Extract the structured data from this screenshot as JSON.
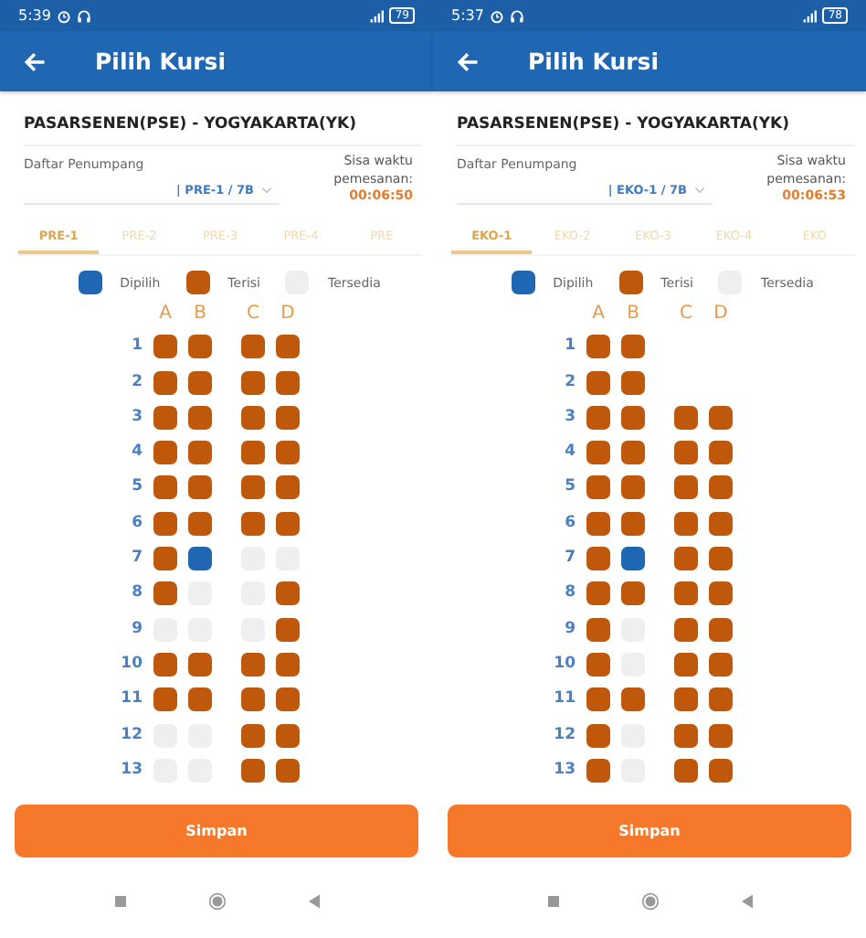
{
  "phones": [
    {
      "status_bar": {
        "time": "5:39",
        "battery": "79"
      },
      "title": "Pilih Kursi",
      "route": "PASARSENEN(PSE) - YOGYAKARTA(YK)",
      "passenger_label": "Daftar Penumpang",
      "passenger_value": "| PRE-1 / 7B",
      "timer_label": "Sisa waktu pemesanan:",
      "timer": "00:06:50",
      "tabs": [
        {
          "label": "PRE-1",
          "selected": true
        },
        {
          "label": "PRE-2",
          "selected": false
        },
        {
          "label": "PRE-3",
          "selected": false
        },
        {
          "label": "PRE-4",
          "selected": false
        },
        {
          "label": "PRE",
          "selected": false
        }
      ],
      "legend": [
        {
          "label": "Dipilih",
          "selected": true,
          "occupied": false
        },
        {
          "label": "Terisi",
          "selected": false,
          "occupied": true
        },
        {
          "label": "Tersedia",
          "selected": false,
          "occupied": false
        }
      ],
      "columns": [
        "A",
        "B",
        "C",
        "D"
      ],
      "rows": [
        {
          "number": "1",
          "seats": [
            {
              "selected": false,
              "occupied": true
            },
            {
              "selected": false,
              "occupied": true
            },
            {
              "selected": false,
              "occupied": true
            },
            {
              "selected": false,
              "occupied": true
            }
          ]
        },
        {
          "number": "2",
          "seats": [
            {
              "selected": false,
              "occupied": true
            },
            {
              "selected": false,
              "occupied": true
            },
            {
              "selected": false,
              "occupied": true
            },
            {
              "selected": false,
              "occupied": true
            }
          ]
        },
        {
          "number": "3",
          "seats": [
            {
              "selected": false,
              "occupied": true
            },
            {
              "selected": false,
              "occupied": true
            },
            {
              "selected": false,
              "occupied": true
            },
            {
              "selected": false,
              "occupied": true
            }
          ]
        },
        {
          "number": "4",
          "seats": [
            {
              "selected": false,
              "occupied": true
            },
            {
              "selected": false,
              "occupied": true
            },
            {
              "selected": false,
              "occupied": true
            },
            {
              "selected": false,
              "occupied": true
            }
          ]
        },
        {
          "number": "5",
          "seats": [
            {
              "selected": false,
              "occupied": true
            },
            {
              "selected": false,
              "occupied": true
            },
            {
              "selected": false,
              "occupied": true
            },
            {
              "selected": false,
              "occupied": true
            }
          ]
        },
        {
          "number": "6",
          "seats": [
            {
              "selected": false,
              "occupied": true
            },
            {
              "selected": false,
              "occupied": true
            },
            {
              "selected": false,
              "occupied": true
            },
            {
              "selected": false,
              "occupied": true
            }
          ]
        },
        {
          "number": "7",
          "seats": [
            {
              "selected": false,
              "occupied": true
            },
            {
              "selected": true,
              "occupied": false
            },
            {
              "selected": false,
              "occupied": false
            },
            {
              "selected": false,
              "occupied": false
            }
          ]
        },
        {
          "number": "8",
          "seats": [
            {
              "selected": false,
              "occupied": true
            },
            {
              "selected": false,
              "occupied": false
            },
            {
              "selected": false,
              "occupied": false
            },
            {
              "selected": false,
              "occupied": true
            }
          ]
        },
        {
          "number": "9",
          "seats": [
            {
              "selected": false,
              "occupied": false
            },
            {
              "selected": false,
              "occupied": false
            },
            {
              "selected": false,
              "occupied": false
            },
            {
              "selected": false,
              "occupied": true
            }
          ]
        },
        {
          "number": "10",
          "seats": [
            {
              "selected": false,
              "occupied": true
            },
            {
              "selected": false,
              "occupied": true
            },
            {
              "selected": false,
              "occupied": true
            },
            {
              "selected": false,
              "occupied": true
            }
          ]
        },
        {
          "number": "11",
          "seats": [
            {
              "selected": false,
              "occupied": true
            },
            {
              "selected": false,
              "occupied": true
            },
            {
              "selected": false,
              "occupied": true
            },
            {
              "selected": false,
              "occupied": true
            }
          ]
        },
        {
          "number": "12",
          "seats": [
            {
              "selected": false,
              "occupied": false
            },
            {
              "selected": false,
              "occupied": false
            },
            {
              "selected": false,
              "occupied": true
            },
            {
              "selected": false,
              "occupied": true
            }
          ]
        },
        {
          "number": "13",
          "seats": [
            {
              "selected": false,
              "occupied": false
            },
            {
              "selected": false,
              "occupied": false
            },
            {
              "selected": false,
              "occupied": true
            },
            {
              "selected": false,
              "occupied": true
            }
          ]
        }
      ],
      "button": "Simpan"
    },
    {
      "status_bar": {
        "time": "5:37",
        "battery": "78"
      },
      "title": "Pilih Kursi",
      "route": "PASARSENEN(PSE) - YOGYAKARTA(YK)",
      "passenger_label": "Daftar Penumpang",
      "passenger_value": "| EKO-1 / 7B",
      "timer_label": "Sisa waktu pemesanan:",
      "timer": "00:06:53",
      "tabs": [
        {
          "label": "EKO-1",
          "selected": true
        },
        {
          "label": "EKO-2",
          "selected": false
        },
        {
          "label": "EKO-3",
          "selected": false
        },
        {
          "label": "EKO-4",
          "selected": false
        },
        {
          "label": "EKO",
          "selected": false
        }
      ],
      "legend": [
        {
          "label": "Dipilih",
          "selected": true,
          "occupied": false
        },
        {
          "label": "Terisi",
          "selected": false,
          "occupied": true
        },
        {
          "label": "Tersedia",
          "selected": false,
          "occupied": false
        }
      ],
      "columns": [
        "A",
        "B",
        "C",
        "D"
      ],
      "rows": [
        {
          "number": "1",
          "seats": [
            {
              "selected": false,
              "occupied": true
            },
            {
              "selected": false,
              "occupied": true
            }
          ]
        },
        {
          "number": "2",
          "seats": [
            {
              "selected": false,
              "occupied": true
            },
            {
              "selected": false,
              "occupied": true
            }
          ]
        },
        {
          "number": "3",
          "seats": [
            {
              "selected": false,
              "occupied": true
            },
            {
              "selected": false,
              "occupied": true
            },
            {
              "selected": false,
              "occupied": true
            },
            {
              "selected": false,
              "occupied": true
            }
          ]
        },
        {
          "number": "4",
          "seats": [
            {
              "selected": false,
              "occupied": true
            },
            {
              "selected": false,
              "occupied": true
            },
            {
              "selected": false,
              "occupied": true
            },
            {
              "selected": false,
              "occupied": true
            }
          ]
        },
        {
          "number": "5",
          "seats": [
            {
              "selected": false,
              "occupied": true
            },
            {
              "selected": false,
              "occupied": true
            },
            {
              "selected": false,
              "occupied": true
            },
            {
              "selected": false,
              "occupied": true
            }
          ]
        },
        {
          "number": "6",
          "seats": [
            {
              "selected": false,
              "occupied": true
            },
            {
              "selected": false,
              "occupied": true
            },
            {
              "selected": false,
              "occupied": true
            },
            {
              "selected": false,
              "occupied": true
            }
          ]
        },
        {
          "number": "7",
          "seats": [
            {
              "selected": false,
              "occupied": true
            },
            {
              "selected": true,
              "occupied": false
            },
            {
              "selected": false,
              "occupied": true
            },
            {
              "selected": false,
              "occupied": true
            }
          ]
        },
        {
          "number": "8",
          "seats": [
            {
              "selected": false,
              "occupied": true
            },
            {
              "selected": false,
              "occupied": true
            },
            {
              "selected": false,
              "occupied": true
            },
            {
              "selected": false,
              "occupied": true
            }
          ]
        },
        {
          "number": "9",
          "seats": [
            {
              "selected": false,
              "occupied": true
            },
            {
              "selected": false,
              "occupied": false
            },
            {
              "selected": false,
              "occupied": true
            },
            {
              "selected": false,
              "occupied": true
            }
          ]
        },
        {
          "number": "10",
          "seats": [
            {
              "selected": false,
              "occupied": true
            },
            {
              "selected": false,
              "occupied": false
            },
            {
              "selected": false,
              "occupied": true
            },
            {
              "selected": false,
              "occupied": true
            }
          ]
        },
        {
          "number": "11",
          "seats": [
            {
              "selected": false,
              "occupied": true
            },
            {
              "selected": false,
              "occupied": true
            },
            {
              "selected": false,
              "occupied": true
            },
            {
              "selected": false,
              "occupied": true
            }
          ]
        },
        {
          "number": "12",
          "seats": [
            {
              "selected": false,
              "occupied": true
            },
            {
              "selected": false,
              "occupied": false
            },
            {
              "selected": false,
              "occupied": true
            },
            {
              "selected": false,
              "occupied": true
            }
          ]
        },
        {
          "number": "13",
          "seats": [
            {
              "selected": false,
              "occupied": true
            },
            {
              "selected": false,
              "occupied": false
            },
            {
              "selected": false,
              "occupied": true
            },
            {
              "selected": false,
              "occupied": true
            }
          ]
        }
      ],
      "button": "Simpan"
    }
  ]
}
